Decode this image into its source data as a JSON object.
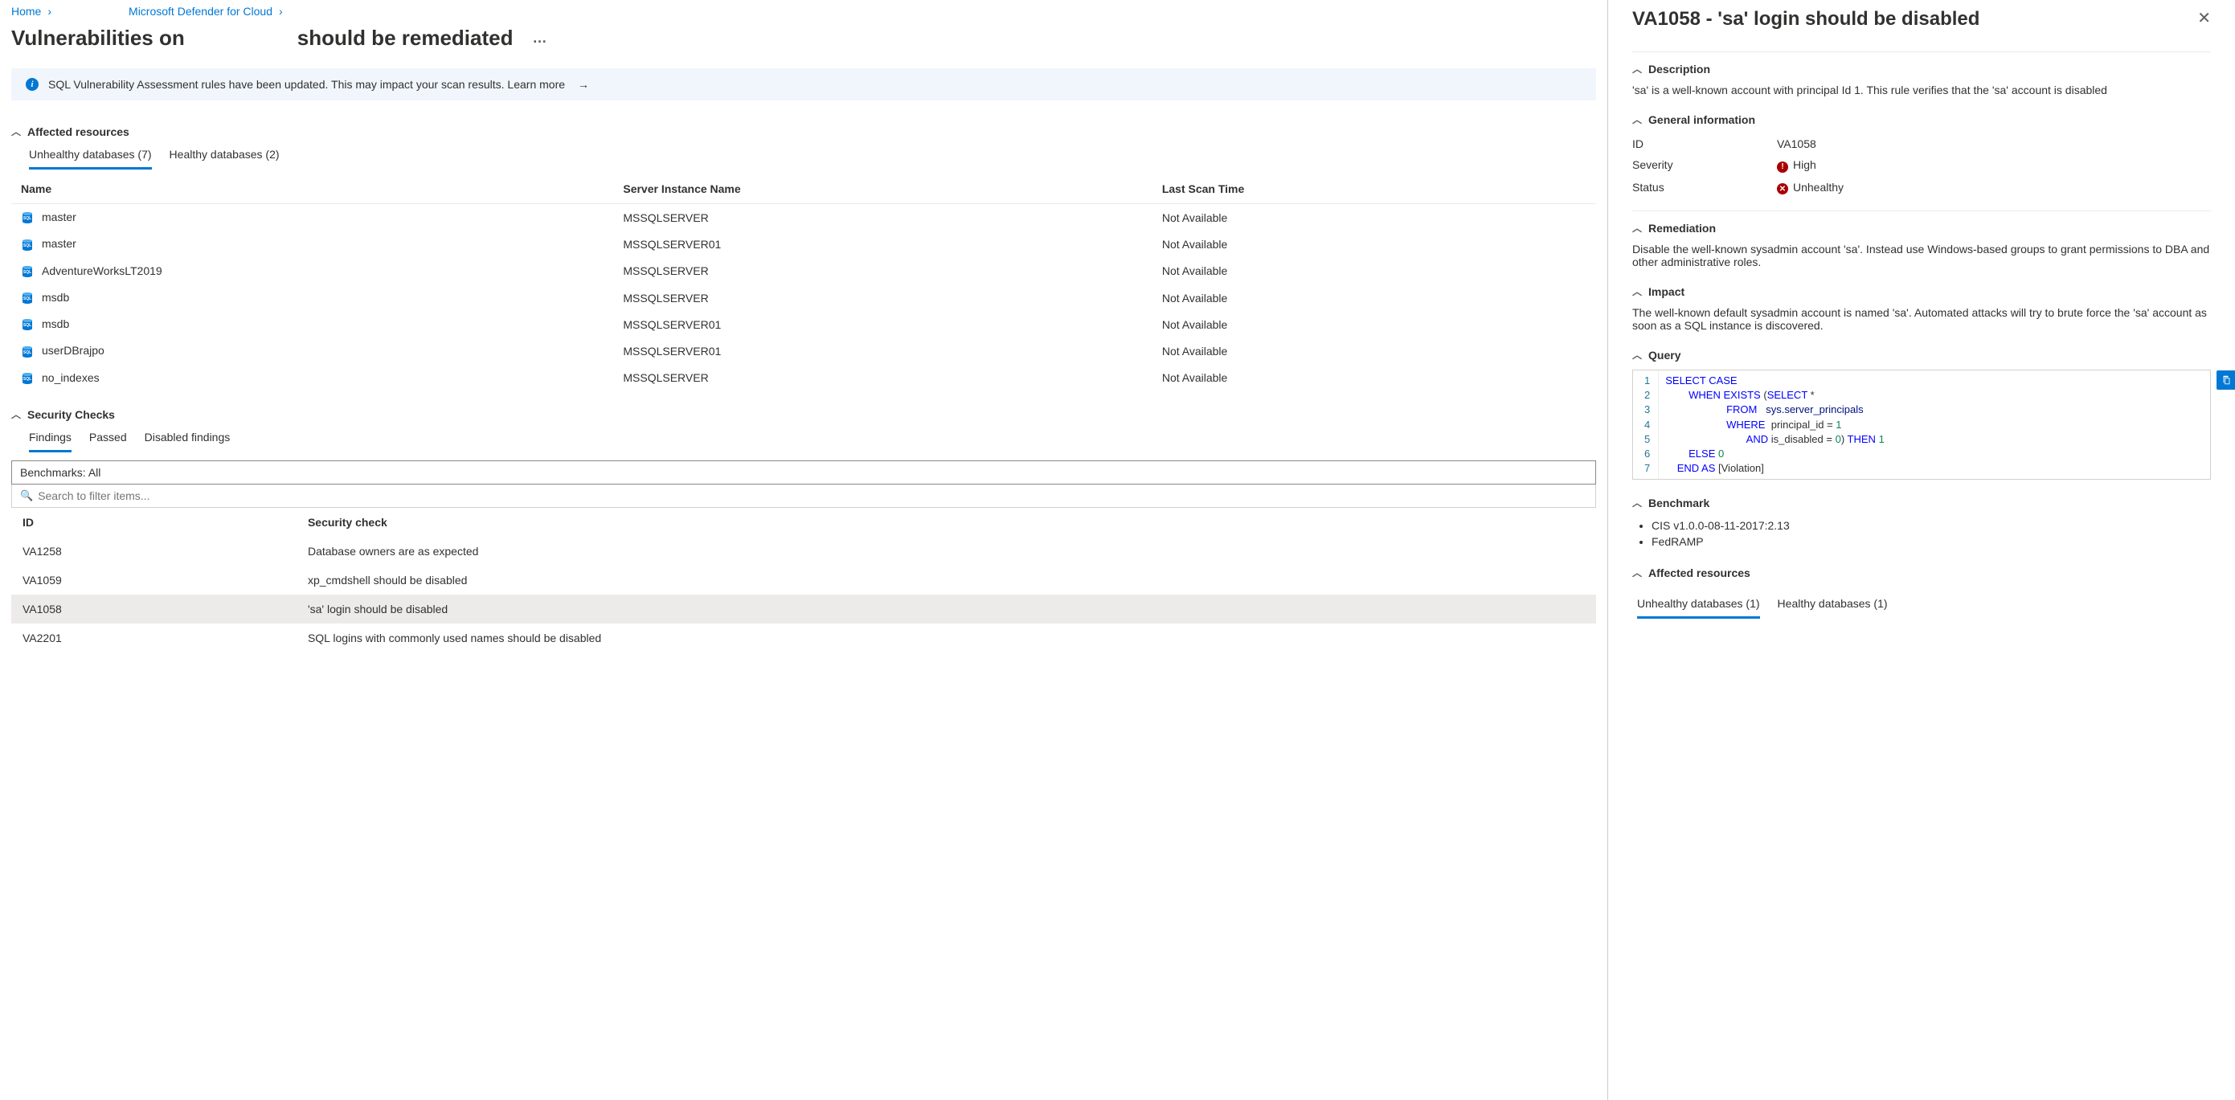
{
  "breadcrumb": {
    "home": "Home",
    "mdc": "Microsoft Defender for Cloud"
  },
  "page_title_1": "Vulnerabilities on",
  "page_title_2": "should be remediated",
  "notice": {
    "text": "SQL Vulnerability Assessment rules have been updated. This may impact your scan results. Learn more"
  },
  "affected": {
    "title": "Affected resources",
    "tabs": {
      "unhealthy": "Unhealthy databases (7)",
      "healthy": "Healthy databases (2)"
    },
    "cols": {
      "name": "Name",
      "server": "Server Instance Name",
      "scan": "Last Scan Time"
    },
    "rows": [
      {
        "name": "master",
        "server": "MSSQLSERVER",
        "scan": "Not Available"
      },
      {
        "name": "master",
        "server": "MSSQLSERVER01",
        "scan": "Not Available"
      },
      {
        "name": "AdventureWorksLT2019",
        "server": "MSSQLSERVER",
        "scan": "Not Available"
      },
      {
        "name": "msdb",
        "server": "MSSQLSERVER",
        "scan": "Not Available"
      },
      {
        "name": "msdb",
        "server": "MSSQLSERVER01",
        "scan": "Not Available"
      },
      {
        "name": "userDBrajpo",
        "server": "MSSQLSERVER01",
        "scan": "Not Available"
      },
      {
        "name": "no_indexes",
        "server": "MSSQLSERVER",
        "scan": "Not Available"
      }
    ]
  },
  "checks": {
    "title": "Security Checks",
    "tabs": {
      "findings": "Findings",
      "passed": "Passed",
      "disabled": "Disabled findings"
    },
    "bench_filter": "Benchmarks: All",
    "search_ph": "Search to filter items...",
    "cols": {
      "id": "ID",
      "check": "Security check"
    },
    "rows": [
      {
        "id": "VA1258",
        "check": "Database owners are as expected",
        "selected": false
      },
      {
        "id": "VA1059",
        "check": "xp_cmdshell should be disabled",
        "selected": false
      },
      {
        "id": "VA1058",
        "check": "'sa' login should be disabled",
        "selected": true
      },
      {
        "id": "VA2201",
        "check": "SQL logins with commonly used names should be disabled",
        "selected": false
      }
    ]
  },
  "detail": {
    "title": "VA1058 - 'sa' login should be disabled",
    "desc_h": "Description",
    "desc": "'sa' is a well-known account with principal Id 1. This rule verifies that the 'sa' account is disabled",
    "gen_h": "General information",
    "gen": {
      "id_l": "ID",
      "id_v": "VA1058",
      "sev_l": "Severity",
      "sev_v": "High",
      "stat_l": "Status",
      "stat_v": "Unhealthy"
    },
    "rem_h": "Remediation",
    "rem": "Disable the well-known sysadmin account 'sa'. Instead use Windows-based groups to grant permissions to DBA and other administrative roles.",
    "imp_h": "Impact",
    "imp": "The well-known default sysadmin account is named 'sa'. Automated attacks will try to brute force the 'sa' account as soon as a SQL instance is discovered.",
    "query_h": "Query",
    "bench_h": "Benchmark",
    "bench": [
      "CIS v1.0.0-08-11-2017:2.13",
      "FedRAMP"
    ],
    "aff_h": "Affected resources",
    "aff_tabs": {
      "unhealthy": "Unhealthy databases (1)",
      "healthy": "Healthy databases (1)"
    }
  }
}
